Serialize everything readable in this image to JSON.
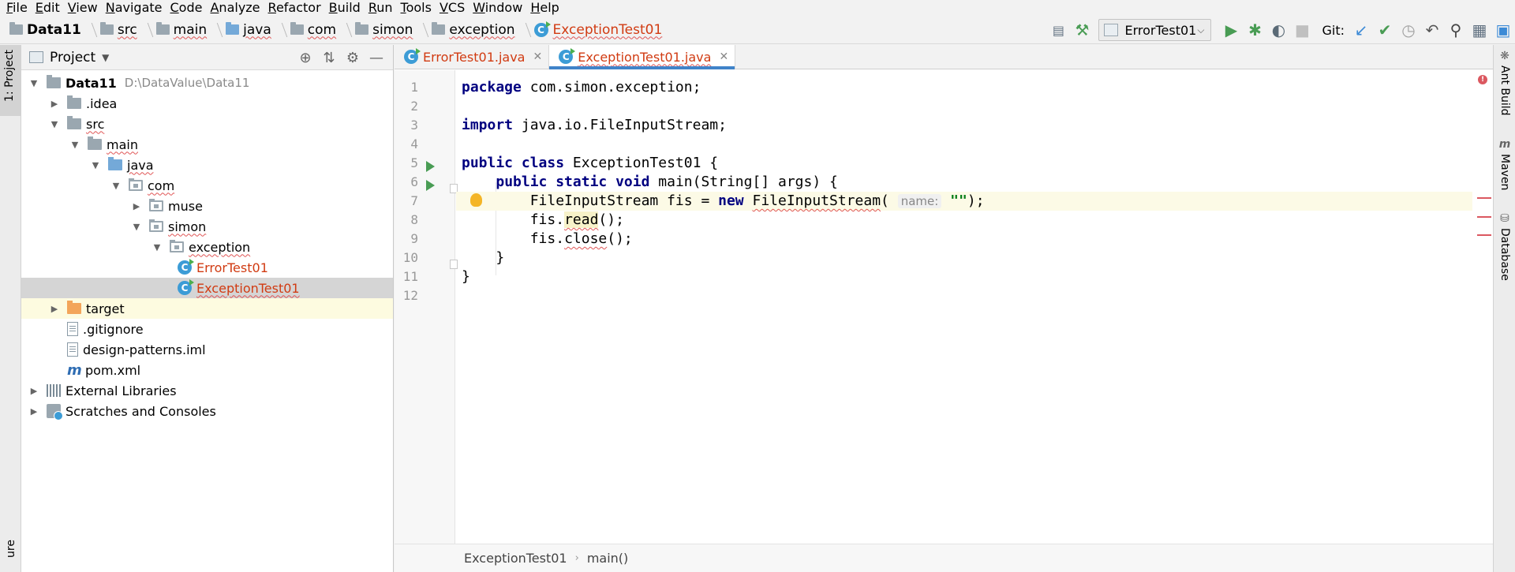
{
  "menu": [
    "File",
    "Edit",
    "View",
    "Navigate",
    "Code",
    "Analyze",
    "Refactor",
    "Build",
    "Run",
    "Tools",
    "VCS",
    "Window",
    "Help"
  ],
  "breadcrumb": {
    "project": "Data11",
    "items": [
      "src",
      "main",
      "java",
      "com",
      "simon",
      "exception"
    ],
    "file": "ExceptionTest01"
  },
  "toolbar": {
    "run_config": "ErrorTest01",
    "git_label": "Git:"
  },
  "left_stripe": {
    "project_tab": "1: Project",
    "bottom_tab": "ure"
  },
  "project_panel": {
    "title": "Project",
    "root_name": "Data11",
    "root_path": "D:\\DataValue\\Data11",
    "nodes": [
      {
        "label": ".idea"
      },
      {
        "label": "src"
      },
      {
        "label": "main"
      },
      {
        "label": "java"
      },
      {
        "label": "com"
      },
      {
        "label": "muse"
      },
      {
        "label": "simon"
      },
      {
        "label": "exception"
      },
      {
        "label": "ErrorTest01"
      },
      {
        "label": "ExceptionTest01"
      },
      {
        "label": "target"
      },
      {
        "label": ".gitignore"
      },
      {
        "label": "design-patterns.iml"
      },
      {
        "label": "pom.xml"
      },
      {
        "label": "External Libraries"
      },
      {
        "label": "Scratches and Consoles"
      }
    ]
  },
  "tabs": [
    {
      "label": "ErrorTest01.java",
      "active": false
    },
    {
      "label": "ExceptionTest01.java",
      "active": true
    }
  ],
  "editor": {
    "line_numbers": [
      "1",
      "2",
      "3",
      "4",
      "5",
      "6",
      "7",
      "8",
      "9",
      "10",
      "11",
      "12"
    ],
    "code": {
      "l1_kw": "package",
      "l1_rest": " com.simon.exception;",
      "l3_kw": "import",
      "l3_rest": " java.io.FileInputStream;",
      "l5_kw": "public class",
      "l5_rest": " ExceptionTest01 {",
      "l6_kw": "public static void",
      "l6_rest": " main(String[] args) {",
      "l7_type": "FileInputStream fis = ",
      "l7_kw": "new",
      "l7_ctor": "FileInputStream",
      "l7_open": "(",
      "l7_hint": "name:",
      "l7_str": "\"\"",
      "l7_end": ");",
      "l8_pre": "fis.",
      "l8_call": "read",
      "l8_end": "();",
      "l9_pre": "fis.",
      "l9_call": "close",
      "l9_end": "();",
      "l10": "}",
      "l11": "}"
    },
    "bottom_breadcrumb": [
      "ExceptionTest01",
      "main()"
    ]
  },
  "right_stripe": [
    "Ant Build",
    "Maven",
    "Database"
  ],
  "colors": {
    "accent": "#4083c9",
    "error_red": "#d13b12",
    "keyword": "#000080",
    "string": "#067d17",
    "run_green": "#499c54"
  }
}
